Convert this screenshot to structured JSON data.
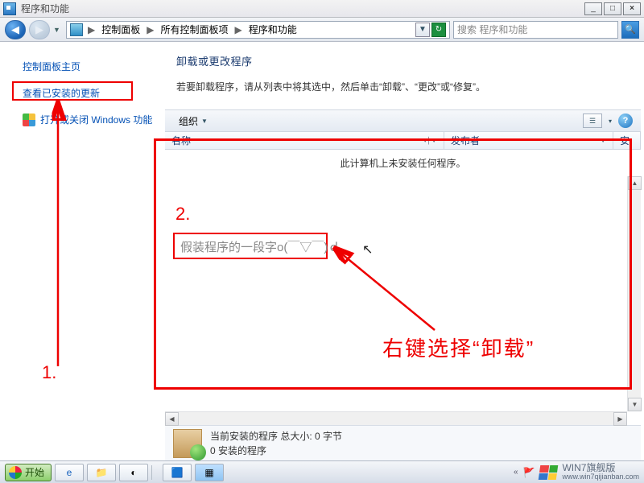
{
  "window": {
    "title": "程序和功能"
  },
  "window_controls": {
    "min": "_",
    "max": "□",
    "close": "×"
  },
  "nav": {
    "back": "◀",
    "forward": "▶",
    "dropdown": "▼",
    "refresh": "↻"
  },
  "breadcrumb": {
    "sep": "▶",
    "items": [
      "控制面板",
      "所有控制面板项",
      "程序和功能"
    ]
  },
  "search": {
    "placeholder": "搜索 程序和功能",
    "icon": "🔍"
  },
  "sidebar": {
    "items": [
      {
        "label": "控制面板主页",
        "icon": ""
      },
      {
        "label": "查看已安装的更新",
        "icon": ""
      },
      {
        "label": "打开或关闭 Windows 功能",
        "icon": "shield"
      }
    ]
  },
  "main": {
    "heading": "卸载或更改程序",
    "subtext": "若要卸载程序，请从列表中将其选中，然后单击“卸载”、“更改”或“修复”。"
  },
  "toolbar": {
    "organize": "组织",
    "dropdown": "▼",
    "view_drop": "▾",
    "help": "?"
  },
  "columns": {
    "name": "名称",
    "publisher": "发布者",
    "installed": "安"
  },
  "list": {
    "empty": "此计算机上未安装任何程序。"
  },
  "status": {
    "line1": "当前安装的程序 总大小: 0 字节",
    "line2": "0 安装的程序"
  },
  "taskbar": {
    "start": "开始"
  },
  "brand": "WIN7旗舰版",
  "brand_url": "www.win7qijianban.com",
  "annotations": {
    "step1": "1.",
    "step2": "2.",
    "fake_program": "假装程序的一段字o(￣▽￣)ｄ",
    "tip": "右键选择“卸载”"
  }
}
